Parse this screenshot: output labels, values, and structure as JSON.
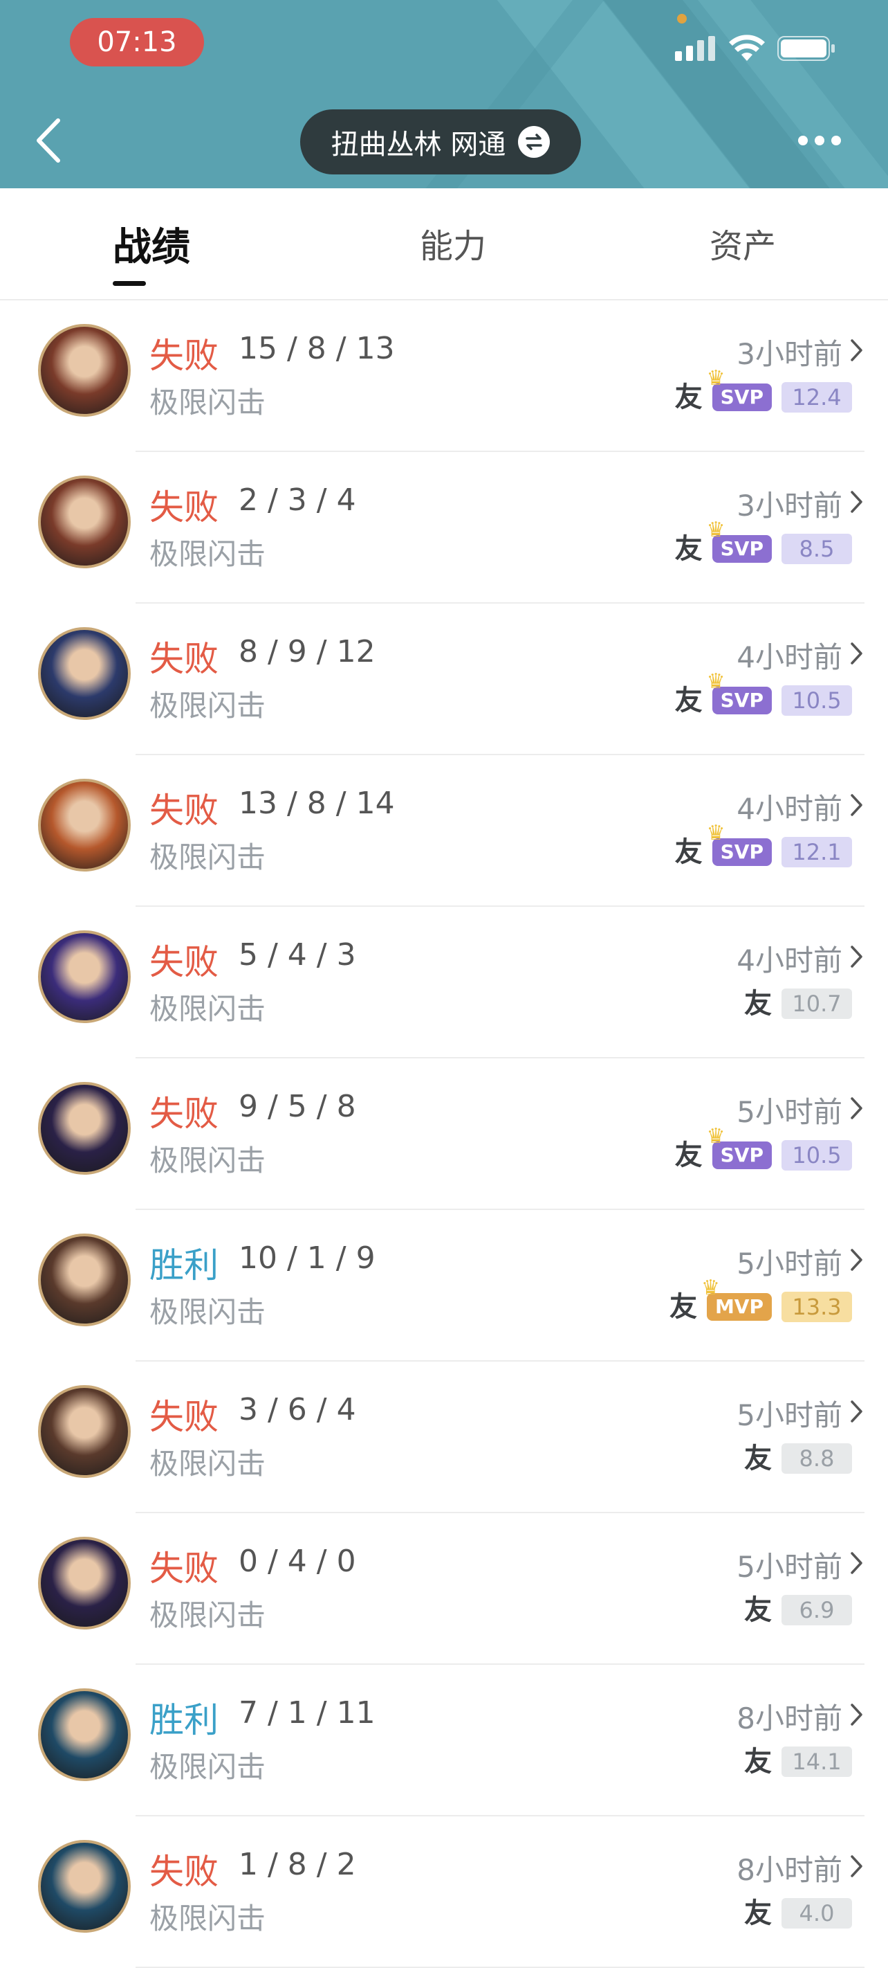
{
  "status_bar": {
    "time": "07:13"
  },
  "header": {
    "title": "扭曲丛林 网通"
  },
  "tabs": [
    {
      "label": "战绩",
      "active": true
    },
    {
      "label": "能力",
      "active": false
    },
    {
      "label": "资产",
      "active": false
    }
  ],
  "friend_label": "友",
  "colors": {
    "lose": "#e35b45",
    "win": "#3aa0c8",
    "header_bg": "#5aa2b0",
    "svp": "#8c6fd1",
    "mvp": "#e3a44a"
  },
  "matches": [
    {
      "result": "失败",
      "outcome": "lose",
      "kda": "15 / 8 / 13",
      "mode": "极限闪击",
      "time": "3小时前",
      "medal": "SVP",
      "score": "12.4",
      "avatar_color": "#7a3b2a"
    },
    {
      "result": "失败",
      "outcome": "lose",
      "kda": "2 / 3 / 4",
      "mode": "极限闪击",
      "time": "3小时前",
      "medal": "SVP",
      "score": "8.5",
      "avatar_color": "#7a3b2a"
    },
    {
      "result": "失败",
      "outcome": "lose",
      "kda": "8 / 9 / 12",
      "mode": "极限闪击",
      "time": "4小时前",
      "medal": "SVP",
      "score": "10.5",
      "avatar_color": "#2c3a6b"
    },
    {
      "result": "失败",
      "outcome": "lose",
      "kda": "13 / 8 / 14",
      "mode": "极限闪击",
      "time": "4小时前",
      "medal": "SVP",
      "score": "12.1",
      "avatar_color": "#b5582c"
    },
    {
      "result": "失败",
      "outcome": "lose",
      "kda": "5 / 4 / 3",
      "mode": "极限闪击",
      "time": "4小时前",
      "medal": "",
      "score": "10.7",
      "avatar_color": "#3b2c7a"
    },
    {
      "result": "失败",
      "outcome": "lose",
      "kda": "9 / 5 / 8",
      "mode": "极限闪击",
      "time": "5小时前",
      "medal": "SVP",
      "score": "10.5",
      "avatar_color": "#2a2147"
    },
    {
      "result": "胜利",
      "outcome": "win",
      "kda": "10 / 1 / 9",
      "mode": "极限闪击",
      "time": "5小时前",
      "medal": "MVP",
      "score": "13.3",
      "avatar_color": "#5a3a2c"
    },
    {
      "result": "失败",
      "outcome": "lose",
      "kda": "3 / 6 / 4",
      "mode": "极限闪击",
      "time": "5小时前",
      "medal": "",
      "score": "8.8",
      "avatar_color": "#5a3a2c"
    },
    {
      "result": "失败",
      "outcome": "lose",
      "kda": "0 / 4 / 0",
      "mode": "极限闪击",
      "time": "5小时前",
      "medal": "",
      "score": "6.9",
      "avatar_color": "#2a2147"
    },
    {
      "result": "胜利",
      "outcome": "win",
      "kda": "7 / 1 / 11",
      "mode": "极限闪击",
      "time": "8小时前",
      "medal": "",
      "score": "14.1",
      "avatar_color": "#1f4a66"
    },
    {
      "result": "失败",
      "outcome": "lose",
      "kda": "1 / 8 / 2",
      "mode": "极限闪击",
      "time": "8小时前",
      "medal": "",
      "score": "4.0",
      "avatar_color": "#1f4a66"
    }
  ]
}
